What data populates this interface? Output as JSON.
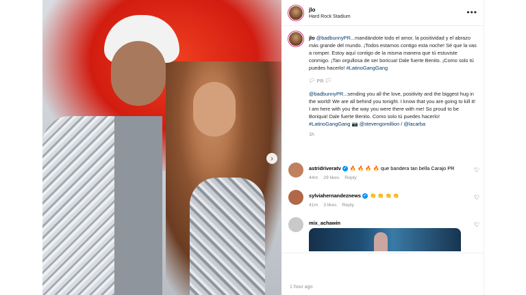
{
  "header": {
    "username": "jlo",
    "location": "Hard Rock Stadium",
    "more_icon": "more-horizontal-icon"
  },
  "caption": {
    "username": "jlo",
    "mention": "@badbunnyPR",
    "spanish_text": "...mandándote todo el amor, la positividad y el abrazo más grande del mundo. ¡Todos estamos contigo esta noche! Sé que la vas a romper. Estoy aquí contigo de la misma manera que tú estuviste conmigo. ¡Tan orgullosa de ser boricua! Dale fuerte Benito. ¡Como solo tú puedes hacerlo!",
    "hashtag": "#LatinoGangGang",
    "flag": "🏳 PR 🏳",
    "en_mention": "@badbunnyPR",
    "english_text": "...sending you all the love, positivity and the biggest hug in the world! We are all behind you tonight. I know that you are going to kill it! I am here with you the way you were there with me! So proud to be Boriqua! Dale fuerte Benito. Como solo tú puedes hacerlo!",
    "en_hashtag": "#LatinoGangGang",
    "camera": "📷",
    "credit1": "@stevengomillion",
    "slash": "/",
    "credit2": "@lacarba",
    "time": "1h"
  },
  "comments": [
    {
      "username": "astridriveratv",
      "text": "🔥 🔥 🔥 🔥 que bandera tan bella Carajo PR",
      "age": "44m",
      "likes": "29 likes",
      "reply": "Reply",
      "avatar_color": "#c08060"
    },
    {
      "username": "sylviahernandeznews",
      "text": "👏 👏 👏 👏",
      "age": "41m",
      "likes": "3 likes",
      "reply": "Reply",
      "avatar_color": "#b06848"
    },
    {
      "username": "mix_achawin",
      "text": "",
      "age": "",
      "likes": "",
      "reply": "",
      "avatar_color": "#c9c9c9"
    }
  ],
  "footer": {
    "time": "1 hour ago"
  },
  "colors": {
    "link": "#00376b",
    "verified": "#0095f6",
    "muted": "#8e8e8e"
  }
}
